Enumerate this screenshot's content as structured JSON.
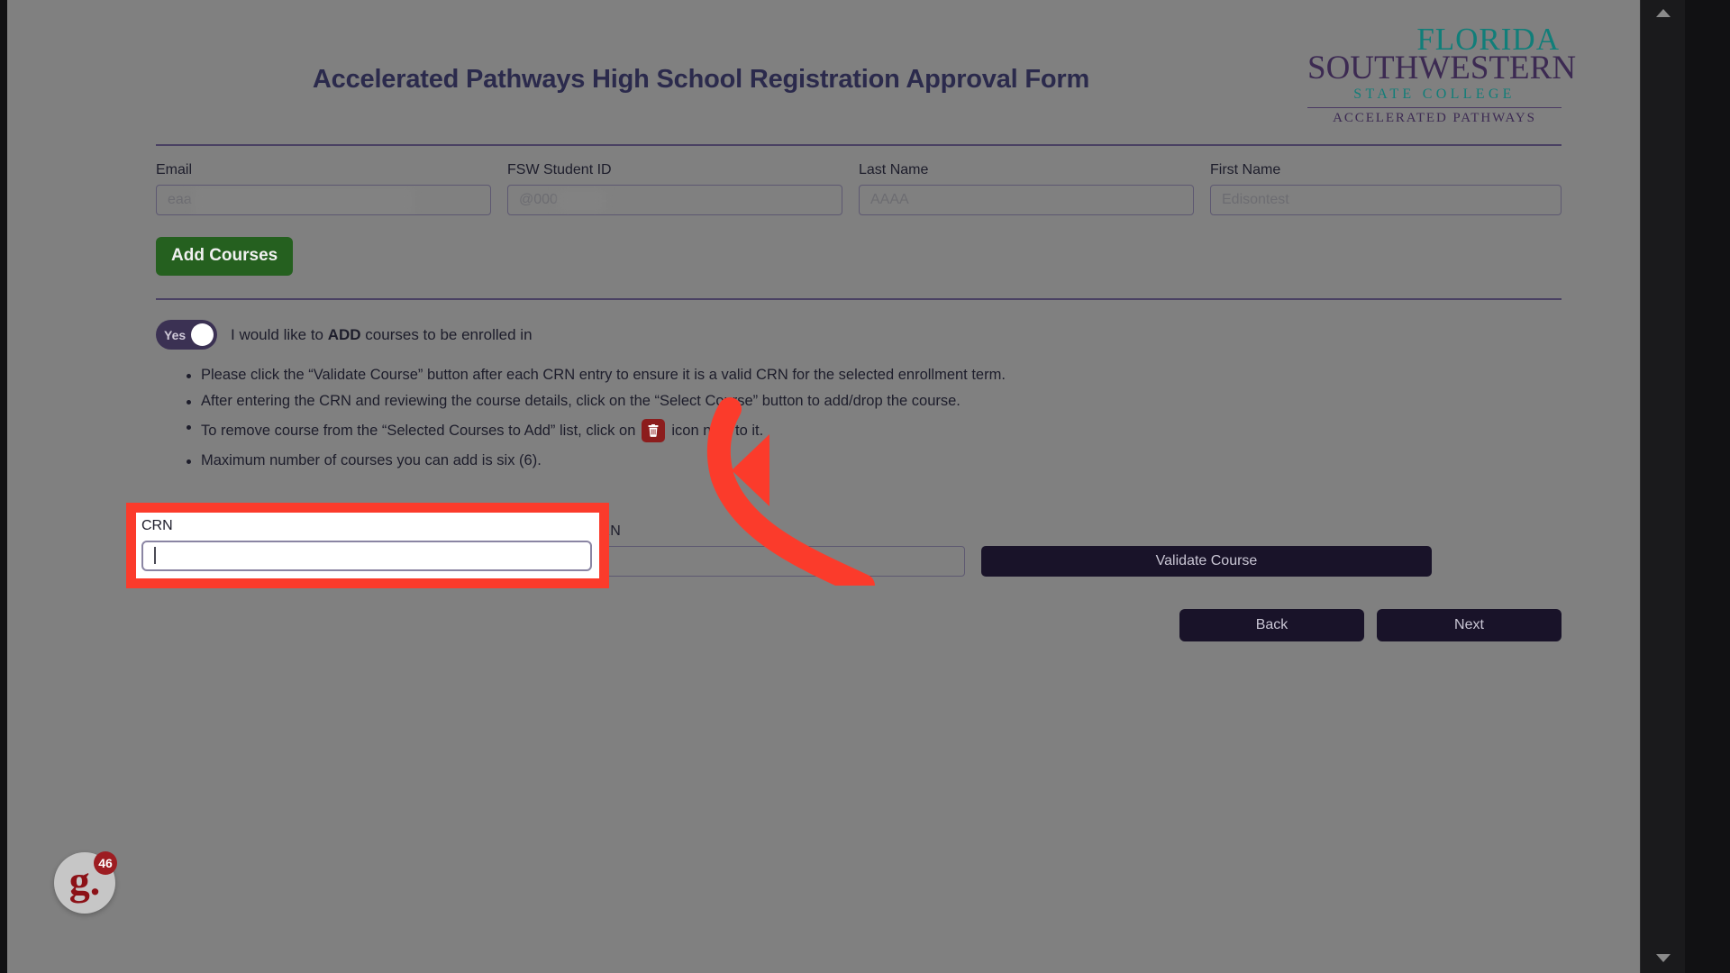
{
  "header": {
    "form_title": "Accelerated Pathways High School Registration Approval Form",
    "logo": {
      "line1": "FLORIDA",
      "line2": "SOUTHWESTERN",
      "line3": "STATE COLLEGE",
      "line4": "ACCELERATED PATHWAYS",
      "teal": "#117e79",
      "purple": "#3c2a52"
    }
  },
  "student_fields": [
    {
      "label": "Email",
      "value": "eaa",
      "redacted": true
    },
    {
      "label": "FSW Student ID",
      "value": "@000",
      "redacted": true
    },
    {
      "label": "Last Name",
      "value": "AAAA",
      "redacted": false
    },
    {
      "label": "First Name",
      "value": "Edisontest",
      "redacted": false
    }
  ],
  "add_courses_button": {
    "label": "Add Courses",
    "color": "#25601f"
  },
  "toggle": {
    "state_label": "Yes",
    "description_prefix": "I would like to ",
    "description_strong": "ADD",
    "description_suffix": " courses to be enrolled in",
    "on": true
  },
  "notes": [
    {
      "text": "Please click the “Validate Course” button after each CRN entry to ensure it is a valid CRN for the selected enrollment term."
    },
    {
      "text": "After entering the CRN and reviewing the course details, click on the “Select Course” button to add/drop the course."
    },
    {
      "text_before": "To remove course from the “Selected Courses to Add” list, click on",
      "icon": "trash-icon",
      "text_after": "icon next to it."
    },
    {
      "text": "Maximum number of courses you can add is six (6)."
    }
  ],
  "crn_section": {
    "crn_label": "CRN",
    "crn_value": "",
    "alt_crn_label": "Alt CRN",
    "alt_crn_value": "",
    "validate_button": "Validate Course",
    "highlight_color": "#fb3b2b"
  },
  "nav_buttons": [
    {
      "label": "Back"
    },
    {
      "label": "Next"
    }
  ],
  "chat_widget": {
    "logo_text": "g.",
    "badge_count": "46"
  },
  "scrollbar": {
    "up_arrow": "scroll-up-arrow",
    "down_arrow": "scroll-down-arrow"
  }
}
